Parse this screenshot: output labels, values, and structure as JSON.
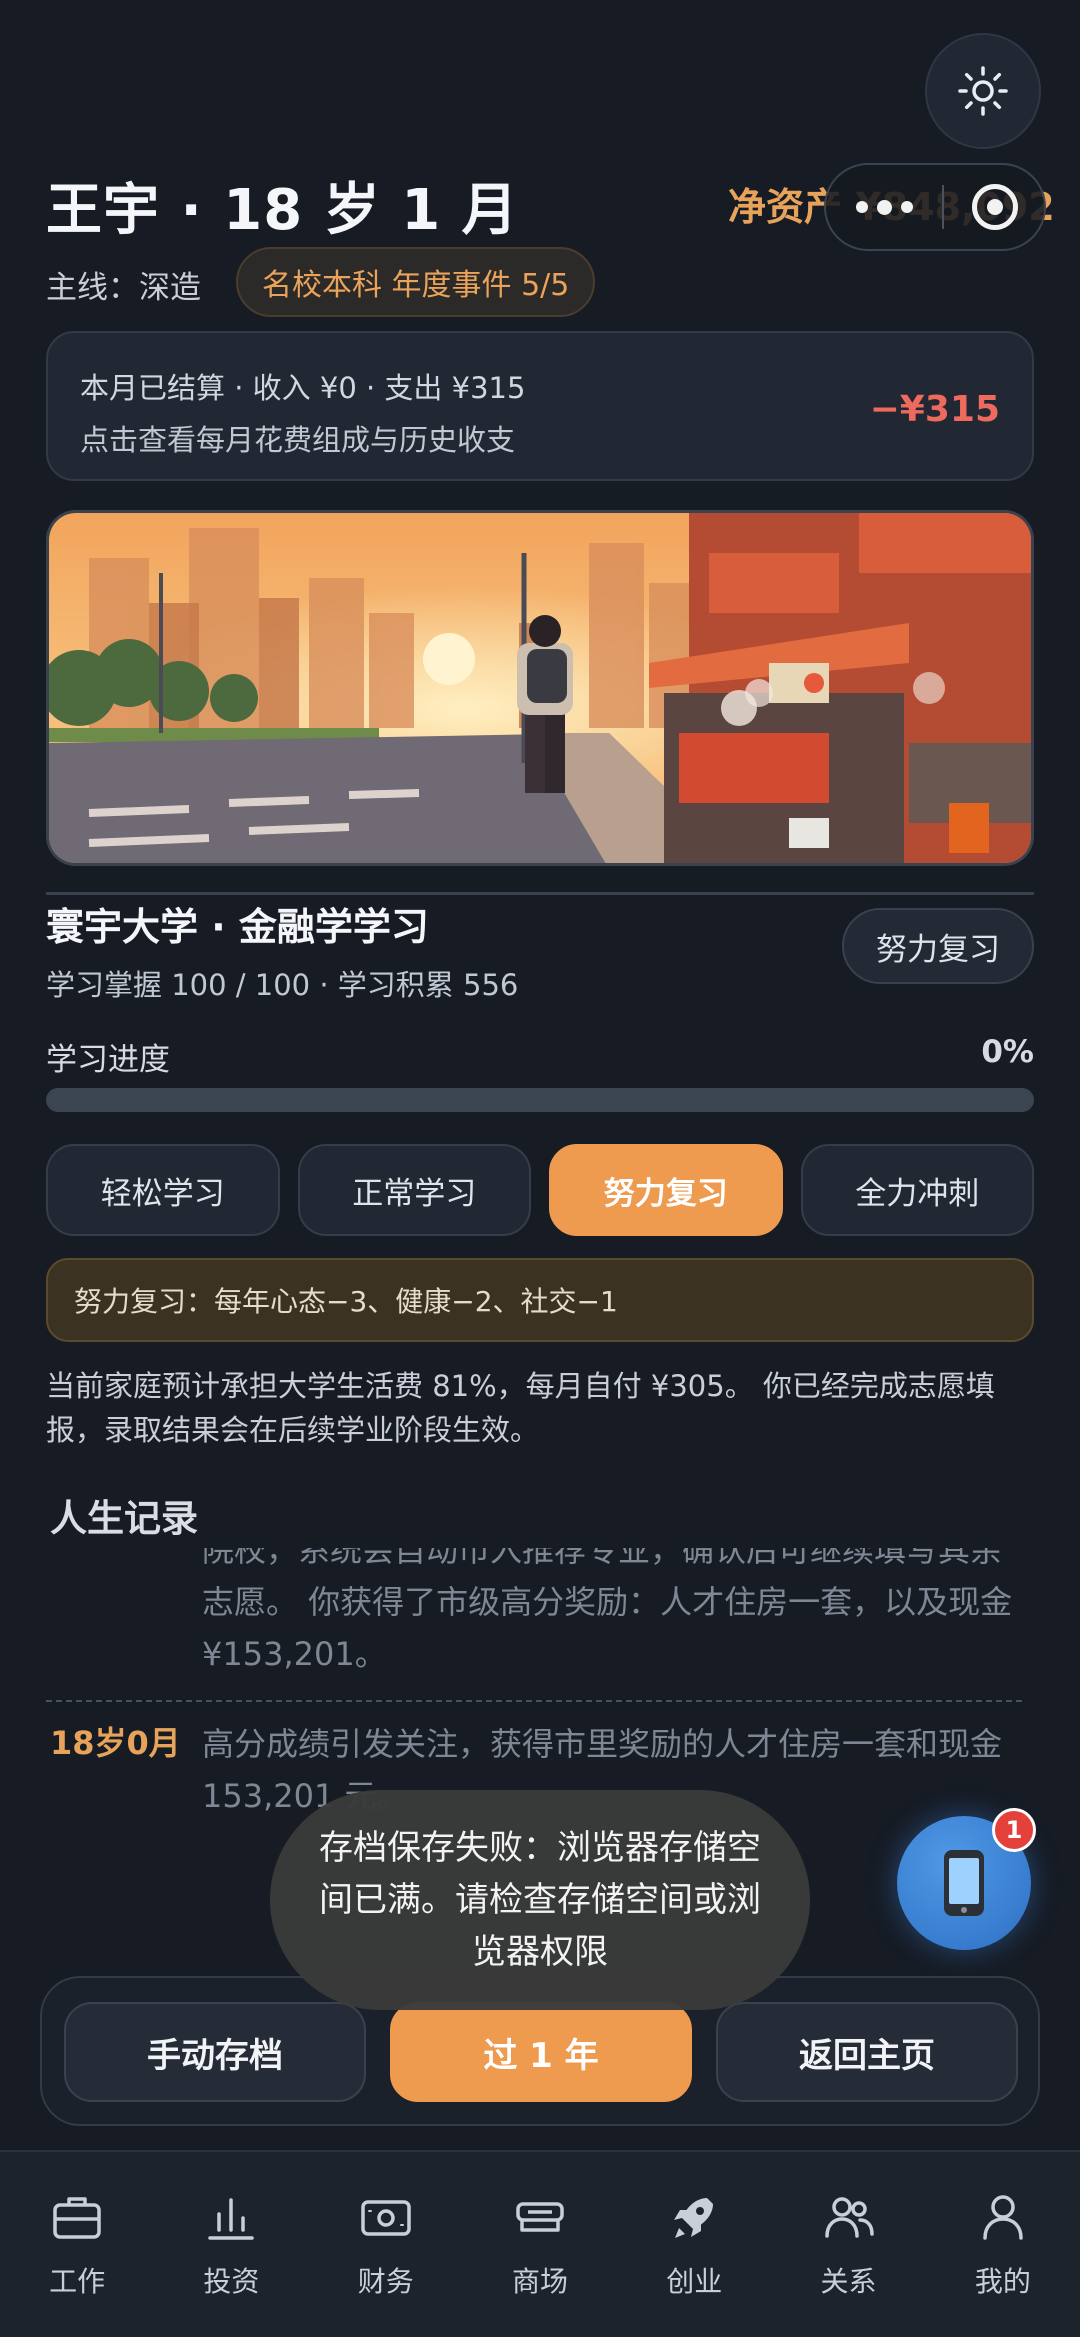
{
  "header": {
    "name_age": "王宇 · 18 岁 1 月",
    "net_worth": "净资产 ¥848,092",
    "mainline_label": "主线：深造",
    "event_chip": "名校本科 年度事件 5/5"
  },
  "settlement": {
    "line1": "本月已结算 · 收入 ¥0 · 支出 ¥315",
    "line2": "点击查看每月花费组成与历史收支",
    "amount": "−¥315"
  },
  "study": {
    "title": "寰宇大学 · 金融学学习",
    "subtitle": "学习掌握 100 / 100 · 学习积累 556",
    "mode_button": "努力复习",
    "progress_label": "学习进度",
    "progress_text": "0%",
    "progress_value": 0,
    "modes": [
      "轻松学习",
      "正常学习",
      "努力复习",
      "全力冲刺"
    ],
    "active_mode_index": 2,
    "effect": "努力复习：每年心态−3、健康−2、社交−1",
    "description": "当前家庭预计承担大学生活费 81%，每月自付 ¥305。 你已经完成志愿填报，录取结果会在后续学业阶段生效。"
  },
  "life_records": {
    "title": "人生记录",
    "entry1_text": "院校，系统会自动市入推荐专业，确认后可继续填写其余志愿。 你获得了市级高分奖励：人才住房一套，以及现金 ¥153,201。",
    "entry2_date": "18岁0月",
    "entry2_text": "高分成绩引发关注，获得市里奖励的人才住房一套和现金 153,201 元。"
  },
  "toast": "存档保存失败：浏览器存储空间已满。请检查存储空间或浏览器权限",
  "phone_badge": "1",
  "actions": {
    "save": "手动存档",
    "next_year": "过 1 年",
    "home": "返回主页"
  },
  "tabs": [
    {
      "label": "工作",
      "icon": "briefcase-icon"
    },
    {
      "label": "投资",
      "icon": "bar-chart-icon"
    },
    {
      "label": "财务",
      "icon": "banknote-icon"
    },
    {
      "label": "商场",
      "icon": "store-icon"
    },
    {
      "label": "创业",
      "icon": "rocket-icon"
    },
    {
      "label": "关系",
      "icon": "people-icon"
    },
    {
      "label": "我的",
      "icon": "person-icon"
    }
  ],
  "colors": {
    "accent": "#ee9a4f",
    "background": "#161b24",
    "negative": "#ef6a5e"
  }
}
